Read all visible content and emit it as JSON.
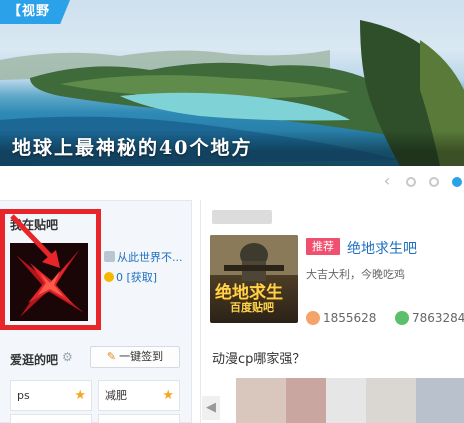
{
  "banner": {
    "tag": "视野",
    "caption": "地球上最神秘的40个地方"
  },
  "carousel": {
    "prev": "‹",
    "dots": 3,
    "active_dot": 3
  },
  "my_tieba": {
    "title": "我在贴吧",
    "username": "从此世界不...",
    "coin_link": "0 [获取]"
  },
  "favorites": {
    "title": "爱逛的吧",
    "sign_all_button": "一键签到",
    "items": [
      {
        "name": "ps"
      },
      {
        "name": "减肥"
      }
    ]
  },
  "feed": {
    "card": {
      "badge": "推荐",
      "bar_name": "绝地求生吧",
      "description": "大吉大利，今晚吃鸡",
      "thumb_title": "绝地求生",
      "thumb_subtitle": "百度贴吧",
      "members": "1855628",
      "posts": "7863284"
    },
    "topic_title": "动漫cp哪家强？"
  },
  "colors": {
    "accent": "#2aa1e8",
    "highlight_box": "#e8262a",
    "badge": "#f0506e",
    "link": "#1f6fbf"
  }
}
